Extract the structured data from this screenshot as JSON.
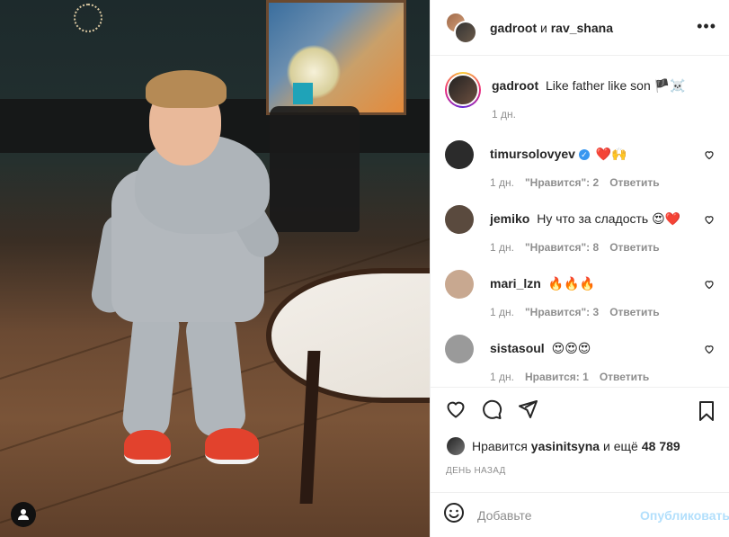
{
  "header": {
    "user1": "gadroot",
    "separator": "и",
    "user2": "rav_shana",
    "more_icon": "more-horizontal-icon"
  },
  "caption": {
    "username": "gadroot",
    "text": "Like father like son 🏴☠️",
    "time": "1 дн."
  },
  "comments": [
    {
      "username": "timursolovyev",
      "verified": true,
      "text": "❤️🙌",
      "time": "1 дн.",
      "likes": "\"Нравится\": 2",
      "reply": "Ответить",
      "avatar_color": "#2b2b2b"
    },
    {
      "username": "jemiko",
      "verified": false,
      "text": "Ну что за сладость 😍❤️",
      "time": "1 дн.",
      "likes": "\"Нравится\": 8",
      "reply": "Ответить",
      "avatar_color": "#5a4a3e"
    },
    {
      "username": "mari_lzn",
      "verified": false,
      "text": "🔥🔥🔥",
      "time": "1 дн.",
      "likes": "\"Нравится\": 3",
      "reply": "Ответить",
      "avatar_color": "#c8a890"
    },
    {
      "username": "sistasoul",
      "verified": false,
      "text": "😍😍😍",
      "time": "1 дн.",
      "likes": "Нравится: 1",
      "reply": "Ответить",
      "avatar_color": "#9a9a9a"
    }
  ],
  "likes": {
    "prefix": "Нравится",
    "user": "yasinitsyna",
    "suffix": "и ещё",
    "count": "48 789"
  },
  "timestamp": "ДЕНЬ НАЗАД",
  "comment_box": {
    "placeholder": "Добавьте",
    "post_label": "Опубликовать"
  },
  "colors": {
    "accent": "#3897f0",
    "post_disabled": "#b2dffc",
    "muted": "#8e8e8e"
  }
}
